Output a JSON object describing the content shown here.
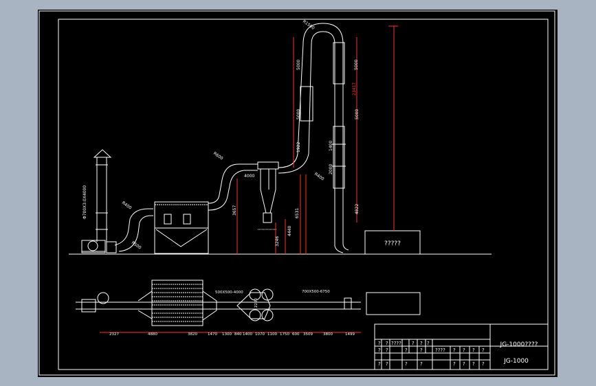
{
  "drawing": {
    "title_label": "JG-1000????",
    "drawing_no": "JG-1000",
    "equipment_label": "?????",
    "total_height": "23417",
    "elevation_dims": {
      "riser_a": "5000",
      "riser_b": "5000",
      "riser_c": "5000",
      "riser_d": "5000",
      "mid_a": "1922",
      "mid_b": "1400",
      "mid_c": "2000",
      "low_a": "4822",
      "low_b": "6531",
      "low_c": "4440",
      "low_d": "3246",
      "low_e": "3657",
      "low_f": "4000",
      "stack": "Φ700X3.0X4000",
      "top": "R1500",
      "inlet_a": "R600",
      "inlet_b": "R400",
      "inlet_c": "R500",
      "inlet_d": "R400"
    },
    "plan_dims": [
      "2327",
      "4880",
      "3820",
      "1470",
      "1300",
      "840",
      "1400",
      "1070",
      "1100",
      "1750",
      "600",
      "3509",
      "3800",
      "1499"
    ],
    "plan_labels": {
      "duct_a": "500X500-4000",
      "duct_b": "700X500-6750",
      "cyclone": "2200"
    },
    "title_block": {
      "row1": [
        "?",
        "?",
        "????",
        "?",
        "?",
        "?"
      ],
      "row2": [
        "?",
        "?",
        "?",
        "?",
        "????",
        "?",
        "?",
        "?",
        "?"
      ],
      "row3": [
        "?",
        "?",
        "?",
        "?",
        "?",
        "?",
        "?",
        "?"
      ]
    }
  }
}
